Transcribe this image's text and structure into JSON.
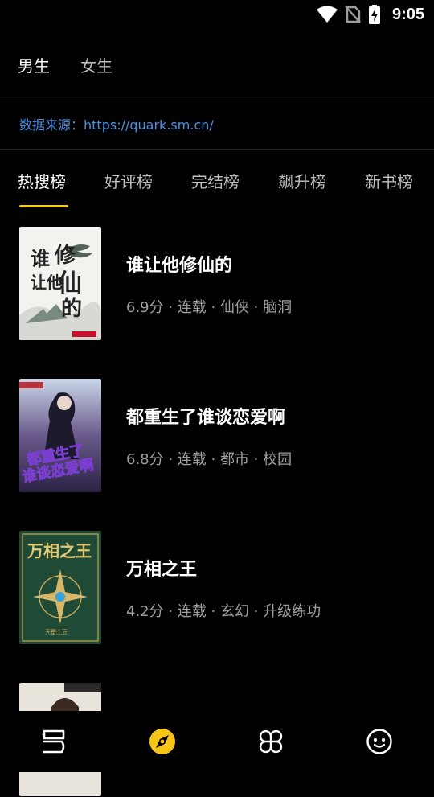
{
  "status_bar": {
    "time": "9:05"
  },
  "gender_tabs": {
    "male": "男生",
    "female": "女生"
  },
  "source": {
    "label": "数据来源：",
    "url": "https://quark.sm.cn/"
  },
  "rank_tabs": [
    "热搜榜",
    "好评榜",
    "完结榜",
    "飙升榜",
    "新书榜"
  ],
  "books": [
    {
      "title": "谁让他修仙的",
      "meta": "6.9分 · 连载 · 仙侠 · 脑洞",
      "cover_text": "谁让他修仙的"
    },
    {
      "title": "都重生了谁谈恋爱啊",
      "meta": "6.8分 · 连载 · 都市 · 校园",
      "cover_text": "都重生了谁谈恋爱啊"
    },
    {
      "title": "万相之王",
      "meta": "4.2分 · 连载 · 玄幻 · 升级练功",
      "cover_text": "万相之王"
    }
  ],
  "bottom_nav": {
    "items": [
      "bookshelf-icon",
      "discover-icon",
      "category-icon",
      "profile-icon"
    ],
    "active": "discover-icon"
  },
  "colors": {
    "accent": "#f5c518",
    "link": "#4a90e2",
    "muted": "#9e9e9e",
    "background": "#000000"
  }
}
